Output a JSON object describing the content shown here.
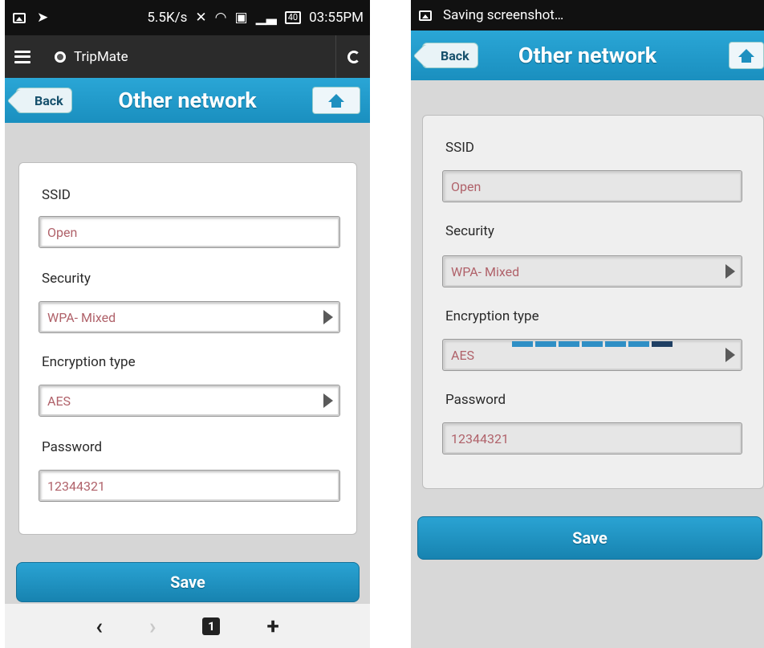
{
  "left": {
    "status": {
      "speed": "5.5K/s",
      "battery": "40",
      "time": "03:55PM"
    },
    "browser": {
      "site": "TripMate"
    },
    "header": {
      "back": "Back",
      "title": "Other network"
    },
    "form": {
      "ssid_label": "SSID",
      "ssid_value": "Open",
      "security_label": "Security",
      "security_value": "WPA- Mixed",
      "encryption_label": "Encryption type",
      "encryption_value": "AES",
      "password_label": "Password",
      "password_value": "12344321"
    },
    "save": "Save",
    "bottombar": {
      "back": "‹",
      "forward": "›",
      "tabs": "1",
      "new_tab": "+"
    }
  },
  "right": {
    "status": {
      "notification": "Saving screenshot…"
    },
    "header": {
      "back": "Back",
      "title": "Other network"
    },
    "form": {
      "ssid_label": "SSID",
      "ssid_value": "Open",
      "security_label": "Security",
      "security_value": "WPA- Mixed",
      "encryption_label": "Encryption type",
      "encryption_value": "AES",
      "password_label": "Password",
      "password_value": "12344321"
    },
    "save": "Save"
  },
  "colors": {
    "header": "#1e98c9",
    "value_text": "#b0626a",
    "save": "#1f8fbf"
  }
}
